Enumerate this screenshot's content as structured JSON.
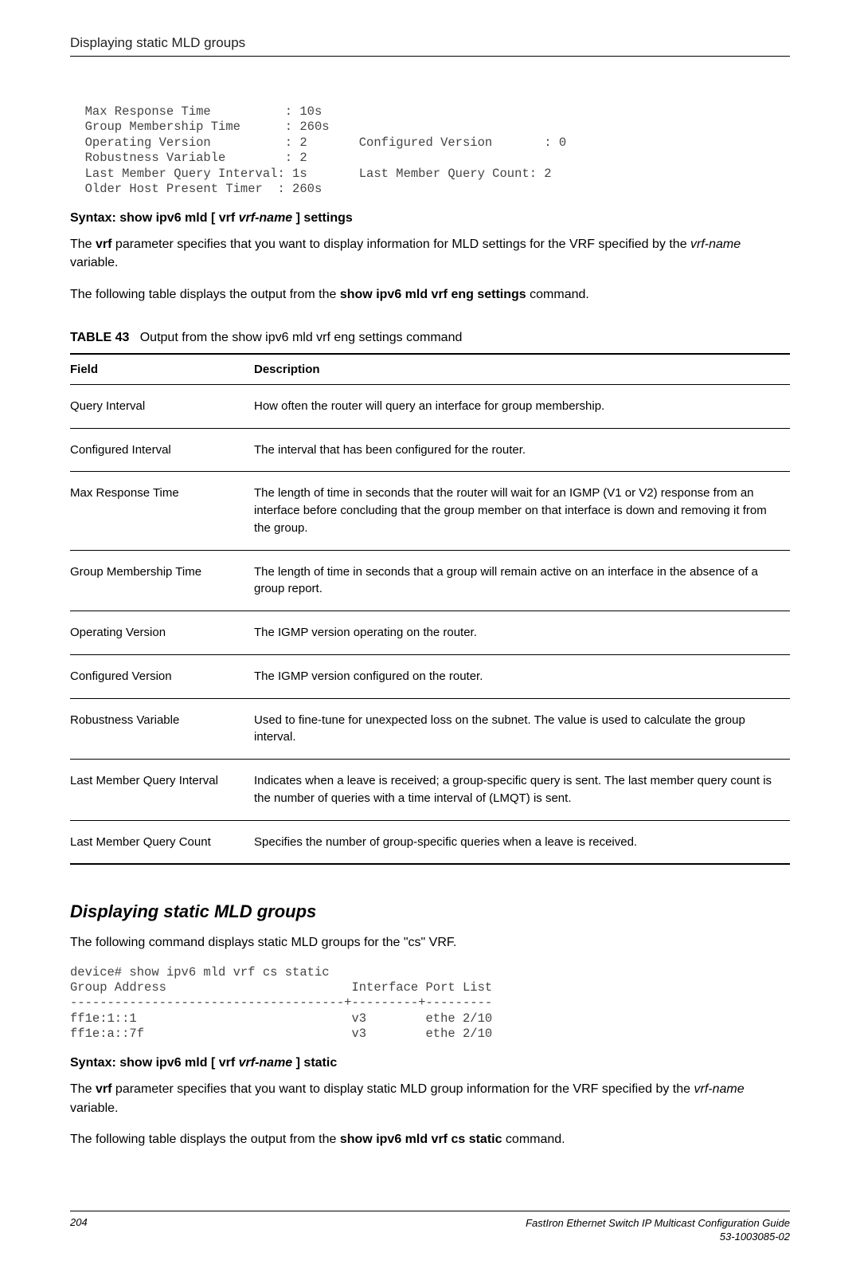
{
  "header": {
    "title": "Displaying static MLD groups"
  },
  "cli_block_1": "  Max Response Time          : 10s\n  Group Membership Time      : 260s\n  Operating Version          : 2       Configured Version       : 0\n  Robustness Variable        : 2\n  Last Member Query Interval: 1s       Last Member Query Count: 2\n  Older Host Present Timer  : 260s",
  "syntax1": {
    "prefix": "Syntax: show ipv6 mld ",
    "lb": "[ ",
    "vrf": "vrf ",
    "vrfname": "vrf-name",
    "rb": " ]",
    "suffix": " settings"
  },
  "para1": {
    "a": "The ",
    "b": "vrf",
    "c": " parameter specifies that you want to display information for MLD settings for the VRF specified by the ",
    "d": "vrf-name",
    "e": " variable."
  },
  "para2": {
    "a": "The following table displays the output from the ",
    "b": "show ipv6 mld vrf eng settings",
    "c": " command."
  },
  "table43": {
    "caption_label": "TABLE 43",
    "caption_text": "Output from the show ipv6 mld vrf eng settings command",
    "head_field": "Field",
    "head_desc": "Description",
    "rows": [
      {
        "field": "Query Interval",
        "desc": "How often the router will query an interface for group membership."
      },
      {
        "field": "Configured Interval",
        "desc": "The interval that has been configured for the router."
      },
      {
        "field": "Max Response Time",
        "desc": "The length of time in seconds that the router will wait for an IGMP (V1 or V2) response from an interface before concluding that the group member on that interface is down and removing it from the group."
      },
      {
        "field": "Group Membership Time",
        "desc": "The length of time in seconds that a group will remain active on an interface in the absence of a group report."
      },
      {
        "field": "Operating Version",
        "desc": "The IGMP version operating on the router."
      },
      {
        "field": "Configured Version",
        "desc": "The IGMP version configured on the router."
      },
      {
        "field": "Robustness Variable",
        "desc": "Used to fine-tune for unexpected loss on the subnet. The value is used to calculate the group interval."
      },
      {
        "field": "Last Member Query Interval",
        "desc": "Indicates when a leave is received; a group-specific query is sent. The last member query count is the number of queries with a time interval of (LMQT) is sent."
      },
      {
        "field": "Last Member Query Count",
        "desc": "Specifies the number of group-specific queries when a leave is received."
      }
    ]
  },
  "section2": {
    "title": "Displaying static MLD groups",
    "intro": "The following command displays static MLD groups for the \"cs\" VRF."
  },
  "cli_block_2": "device# show ipv6 mld vrf cs static\nGroup Address                         Interface Port List\n-------------------------------------+---------+---------\nff1e:1::1                             v3        ethe 2/10\nff1e:a::7f                            v3        ethe 2/10",
  "syntax2": {
    "prefix": "Syntax: show ipv6 mld ",
    "lb": "[ ",
    "vrf": "vrf ",
    "vrfname": "vrf-name",
    "rb": " ]",
    "suffix": " static"
  },
  "para3": {
    "a": "The ",
    "b": "vrf",
    "c": " parameter specifies that you want to display static MLD group information for the VRF specified by the ",
    "d": "vrf-name",
    "e": " variable."
  },
  "para4": {
    "a": "The following table displays the output from the ",
    "b": "show ipv6 mld vrf cs static",
    "c": " command."
  },
  "footer": {
    "page": "204",
    "doc_title": "FastIron Ethernet Switch IP Multicast Configuration Guide",
    "doc_id": "53-1003085-02"
  }
}
